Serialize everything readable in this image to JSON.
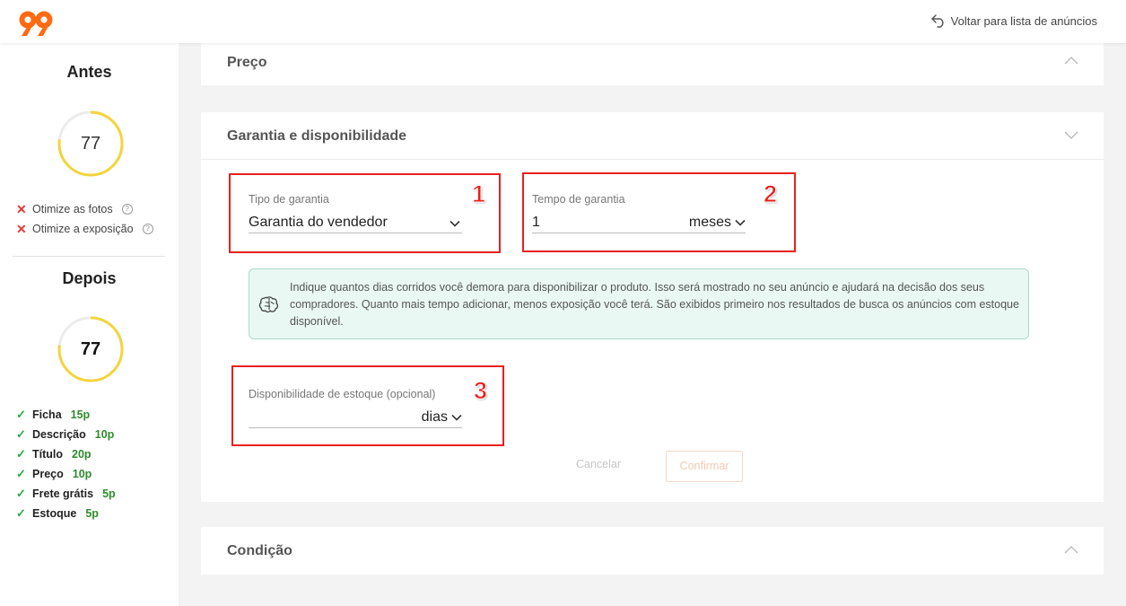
{
  "header": {
    "logo": "99-logo",
    "back_label": "Voltar para lista de anúncios"
  },
  "sidebar": {
    "before": {
      "title": "Antes",
      "score": "77",
      "score_fraction": 0.77,
      "issues": [
        {
          "label": "Otimize as fotos"
        },
        {
          "label": "Otimize a exposição"
        }
      ]
    },
    "after": {
      "title": "Depois",
      "score": "77",
      "score_fraction": 0.77,
      "checks": [
        {
          "label": "Ficha",
          "points": "15p"
        },
        {
          "label": "Descrição",
          "points": "10p"
        },
        {
          "label": "Título",
          "points": "20p"
        },
        {
          "label": "Preço",
          "points": "10p"
        },
        {
          "label": "Frete grátis",
          "points": "5p"
        },
        {
          "label": "Estoque",
          "points": "5p"
        }
      ]
    }
  },
  "sections": {
    "price": {
      "title": "Preço"
    },
    "warranty": {
      "title": "Garantia e disponibilidade",
      "warranty_type": {
        "label": "Tipo de garantia",
        "value": "Garantia do vendedor"
      },
      "warranty_time": {
        "label": "Tempo de garantia",
        "value": "1",
        "unit": "meses"
      },
      "info_text": "Indique quantos dias corridos você demora para disponibilizar o produto. Isso será mostrado no seu anúncio e ajudará na decisão dos seus compradores. Quanto mais tempo adicionar, menos exposição você terá. São exibidos primeiro nos resultados de busca os anúncios com estoque disponível.",
      "stock": {
        "label": "Disponibilidade de estoque (opcional)",
        "value": "",
        "unit": "dias"
      },
      "cancel_label": "Cancelar",
      "confirm_label": "Confirmar"
    },
    "condition": {
      "title": "Condição"
    }
  },
  "annotations": [
    "1",
    "2",
    "3"
  ],
  "colors": {
    "brand_orange": "#ff6a13",
    "gauge_yellow": "#f4d43c",
    "error_red": "#e53935",
    "success_green": "#2ba84a",
    "annotation_red": "#e8201e",
    "info_bg": "#eaf8f4"
  }
}
